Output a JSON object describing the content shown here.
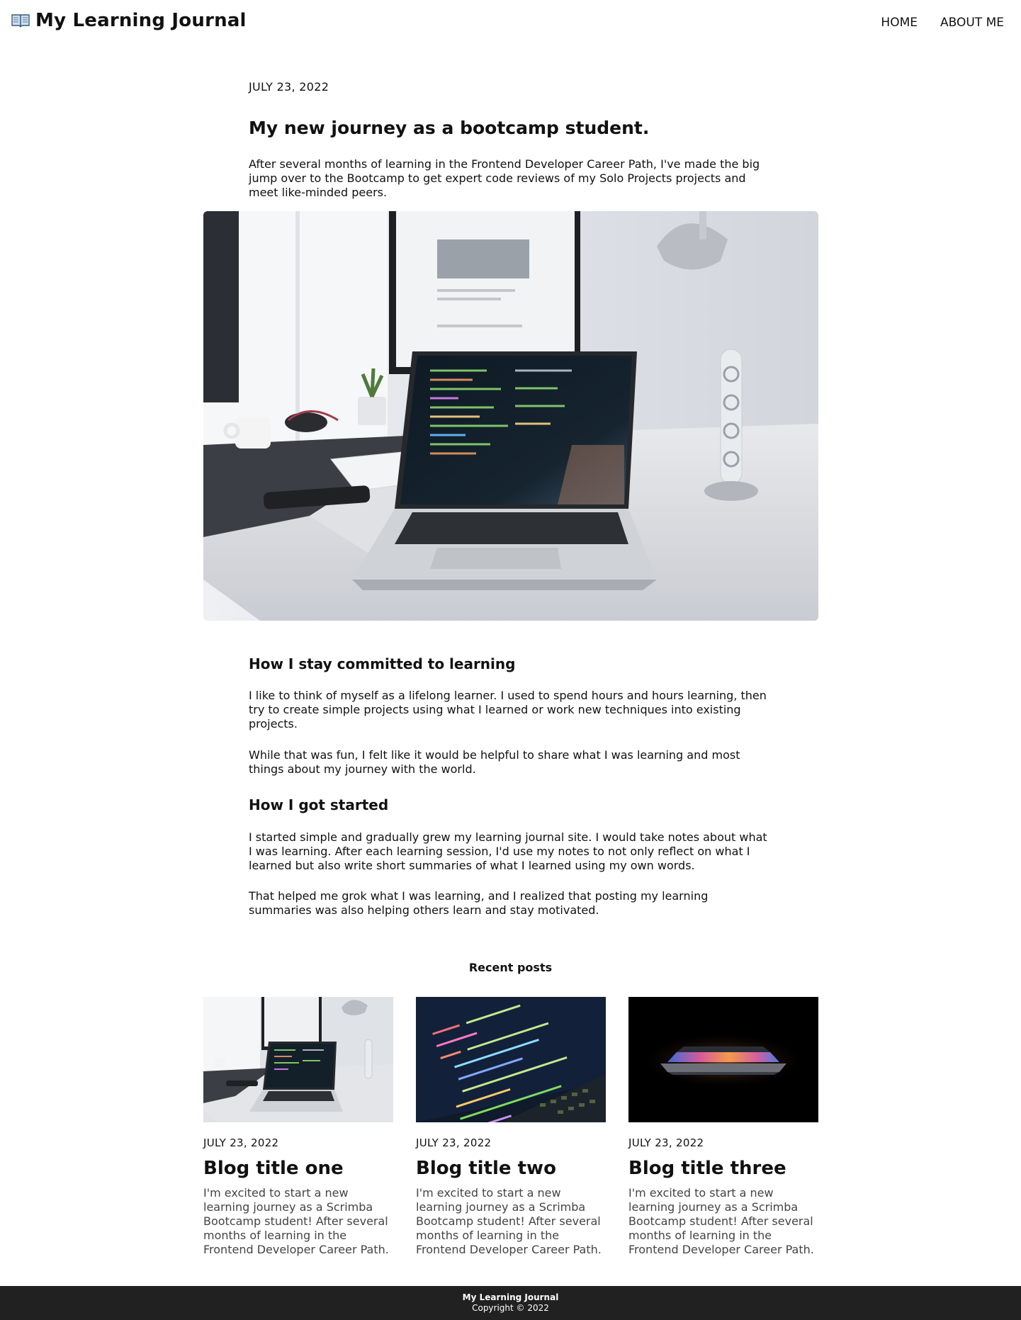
{
  "header": {
    "title": "My Learning Journal",
    "nav": [
      "HOME",
      "ABOUT ME"
    ]
  },
  "post": {
    "date": "JULY 23, 2022",
    "title": "My new journey as a bootcamp student.",
    "lead": "After several months of learning in the Frontend Developer Career Path, I've made the big jump over to the Bootcamp to get expert code reviews of my Solo Projects projects and meet like-minded peers.",
    "sections": [
      {
        "heading": "How I stay committed to learning",
        "paragraphs": [
          "I like to think of myself as a lifelong learner. I used to spend hours and hours learning, then try to create simple projects using what I learned or work new techniques into existing projects.",
          "While that was fun, I felt like it would be helpful to share what I was learning and most things about my journey with the world."
        ]
      },
      {
        "heading": "How I got started",
        "paragraphs": [
          "I started simple and gradually grew my learning journal site. I would take notes about what I was learning. After each learning session, I'd use my notes to not only reflect on what I learned but also write short summaries of what I learned using my own words.",
          "That helped me grok what I was learning, and I realized that posting my learning summaries was also helping others learn and stay motivated."
        ]
      }
    ]
  },
  "recent": {
    "heading": "Recent posts",
    "cards": [
      {
        "date": "JULY 23, 2022",
        "title": "Blog title one",
        "text": "I'm excited to start a new learning journey as a Scrimba Bootcamp student! After several months of learning in the Frontend Developer Career Path."
      },
      {
        "date": "JULY 23, 2022",
        "title": "Blog title two",
        "text": "I'm excited to start a new learning journey as a Scrimba Bootcamp student! After several months of learning in the Frontend Developer Career Path."
      },
      {
        "date": "JULY 23, 2022",
        "title": "Blog title three",
        "text": "I'm excited to start a new learning journey as a Scrimba Bootcamp student! After several months of learning in the Frontend Developer Career Path."
      }
    ]
  },
  "footer": {
    "title": "My Learning Journal",
    "copyright": "Copyright © 2022"
  }
}
